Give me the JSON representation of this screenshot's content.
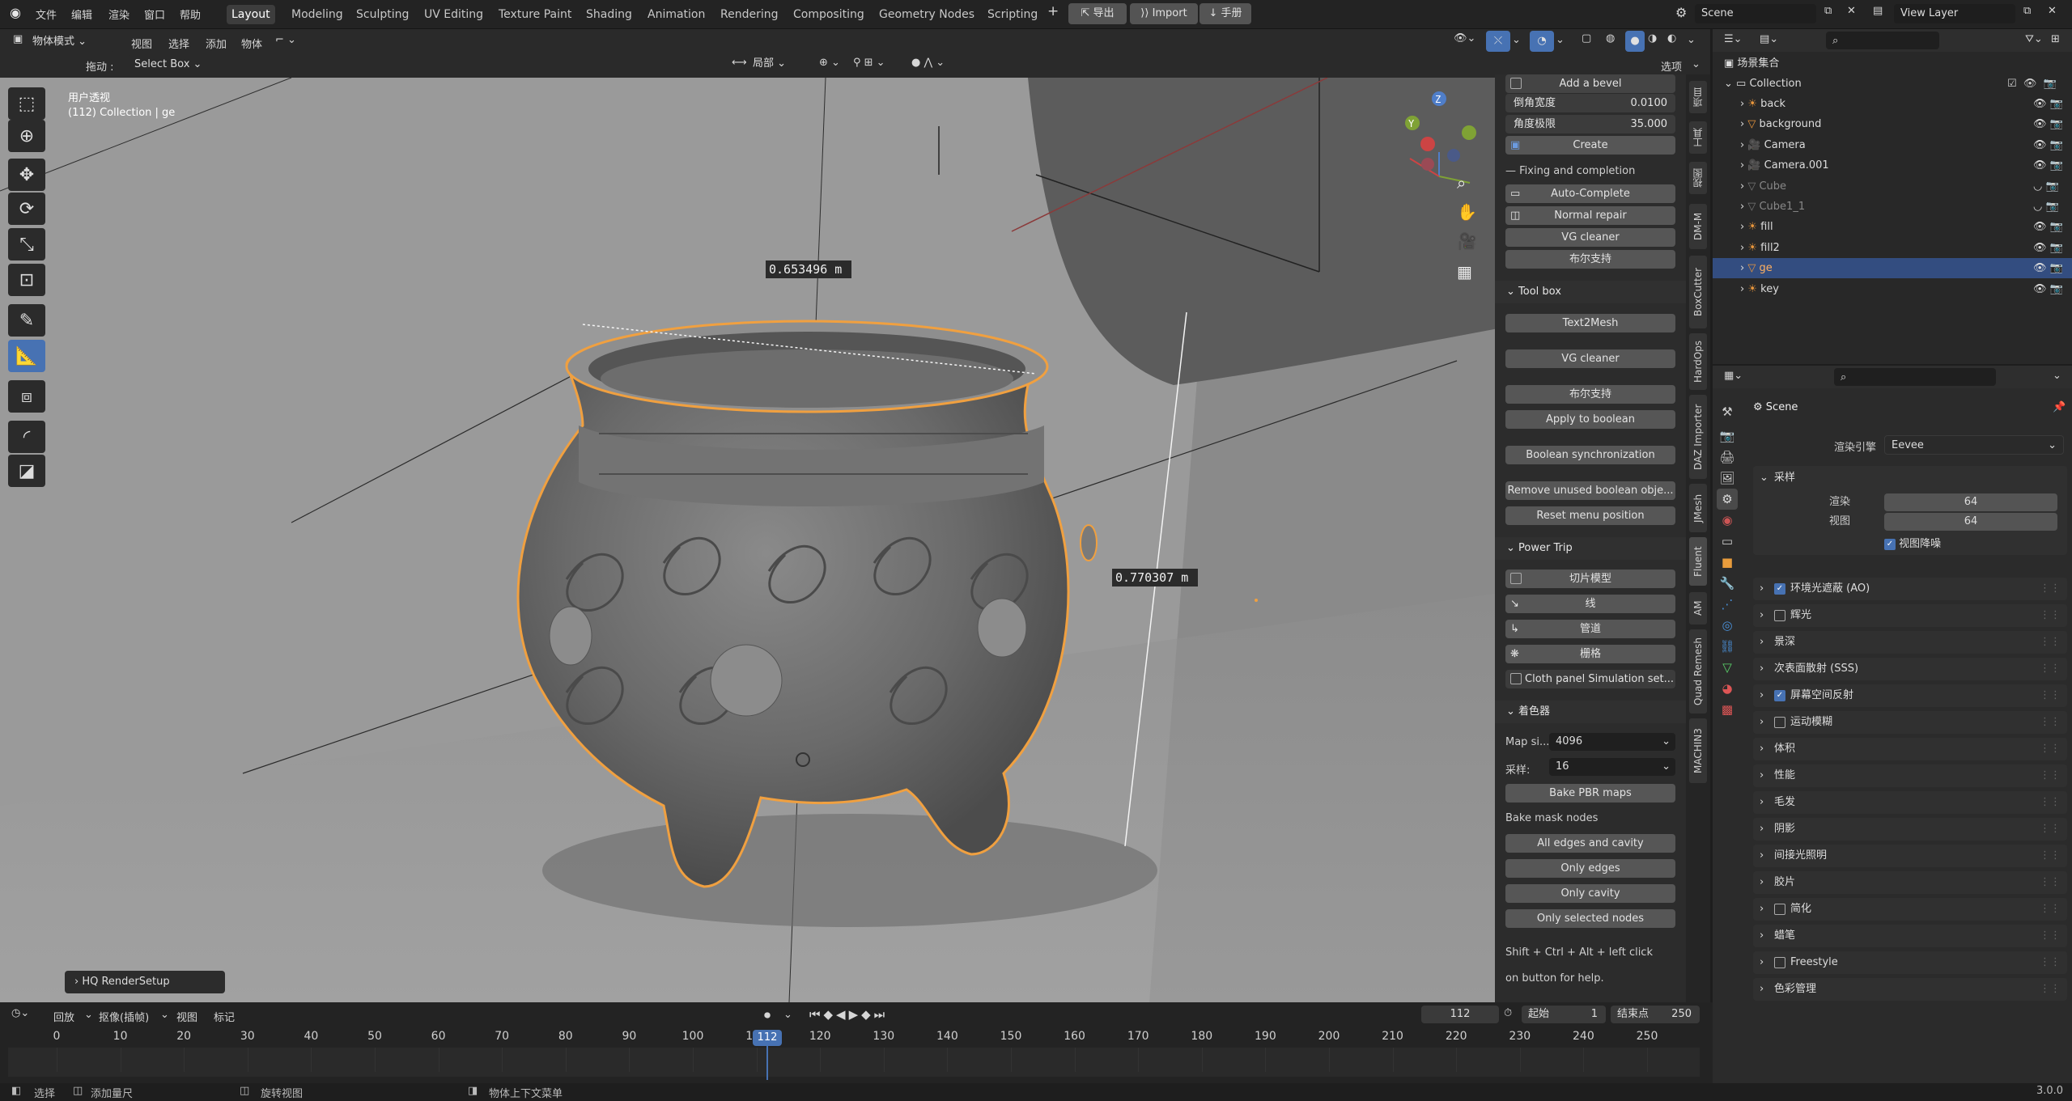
{
  "top_menu": {
    "file": "文件",
    "edit": "编辑",
    "render": "渲染",
    "window": "窗口",
    "help": "帮助"
  },
  "workspaces": [
    "Layout",
    "Modeling",
    "Sculpting",
    "UV Editing",
    "Texture Paint",
    "Shading",
    "Animation",
    "Rendering",
    "Compositing",
    "Geometry Nodes",
    "Scripting"
  ],
  "top_buttons": {
    "export": "导出",
    "import": "Import",
    "manual": "手册"
  },
  "scene": {
    "label": "Scene",
    "view_layer": "View Layer"
  },
  "viewport_header": {
    "mode": "物体模式",
    "view": "视图",
    "select": "选择",
    "add": "添加",
    "object": "物体",
    "drag_label": "拖动 :",
    "select_box": "Select Box",
    "transform": "局部",
    "options": "选项"
  },
  "viewport": {
    "view_name": "用户透视",
    "context": "(112) Collection | ge",
    "measure1": "0.653496 m",
    "measure2": "0.770307 m",
    "hq_setup": "HQ RenderSetup",
    "gizmo_x": "X",
    "gizmo_y": "Y",
    "gizmo_z": "Z"
  },
  "npanel": {
    "add_bevel": "Add a bevel",
    "bevel_width_label": "倒角宽度",
    "bevel_width": "0.0100",
    "angle_label": "角度极限",
    "angle": "35.000",
    "create": "Create",
    "fixing": "Fixing and completion",
    "auto_complete": "Auto-Complete",
    "normal_repair": "Normal repair",
    "vg_cleaner": "VG cleaner",
    "bool_support": "布尔支持",
    "toolbox": "Tool box",
    "text2mesh": "Text2Mesh",
    "vg_cleaner2": "VG cleaner",
    "bool_support2": "布尔支持",
    "apply_boolean": "Apply to boolean",
    "bool_sync": "Boolean synchronization",
    "remove_unused": "Remove unused boolean obje...",
    "reset_menu": "Reset menu position",
    "power_trip": "Power Trip",
    "slice_model": "切片模型",
    "line": "线",
    "pipe": "管道",
    "grid": "栅格",
    "cloth_panel": "Cloth panel",
    "simulation_set": "Simulation set...",
    "shader": "着色器",
    "map_size_label": "Map si...",
    "map_size": "4096",
    "samples_label": "采样:",
    "samples": "16",
    "bake_pbr": "Bake PBR maps",
    "bake_mask": "Bake mask nodes",
    "all_edges": "All edges and cavity",
    "only_edges": "Only edges",
    "only_cavity": "Only cavity",
    "only_selected": "Only selected nodes",
    "help1": "Shift + Ctrl + Alt + left click",
    "help2": "on button for help."
  },
  "side_tabs": [
    "项目",
    "工具",
    "视图",
    "DM-M",
    "BoxCutter",
    "HardOps",
    "DAZ Importer",
    "JMesh",
    "Fluent",
    "AM",
    "Quad Remesh",
    "MACHIN3"
  ],
  "outliner": {
    "root": "场景集合",
    "collection": "Collection",
    "items": [
      {
        "name": "back",
        "disabled": false,
        "selected": false
      },
      {
        "name": "background",
        "disabled": false,
        "selected": false
      },
      {
        "name": "Camera",
        "disabled": false,
        "selected": false
      },
      {
        "name": "Camera.001",
        "disabled": false,
        "selected": false
      },
      {
        "name": "Cube",
        "disabled": true,
        "selected": false
      },
      {
        "name": "Cube1_1",
        "disabled": true,
        "selected": false
      },
      {
        "name": "fill",
        "disabled": false,
        "selected": false
      },
      {
        "name": "fill2",
        "disabled": false,
        "selected": false
      },
      {
        "name": "ge",
        "disabled": false,
        "selected": true
      },
      {
        "name": "key",
        "disabled": false,
        "selected": false
      }
    ]
  },
  "properties": {
    "scene": "Scene",
    "render_engine_label": "渲染引擎",
    "render_engine": "Eevee",
    "sampling": "采样",
    "render_label": "渲染",
    "render_val": "64",
    "viewport_label": "视图",
    "viewport_val": "64",
    "denoise": "视图降噪",
    "sections": [
      {
        "label": "环境光遮蔽 (AO)",
        "check": "on"
      },
      {
        "label": "辉光",
        "check": "off"
      },
      {
        "label": "景深",
        "check": "none"
      },
      {
        "label": "次表面散射 (SSS)",
        "check": "none"
      },
      {
        "label": "屏幕空间反射",
        "check": "on"
      },
      {
        "label": "运动模糊",
        "check": "off"
      },
      {
        "label": "体积",
        "check": "none"
      },
      {
        "label": "性能",
        "check": "none"
      },
      {
        "label": "毛发",
        "check": "none"
      },
      {
        "label": "阴影",
        "check": "none"
      },
      {
        "label": "间接光照明",
        "check": "none"
      },
      {
        "label": "胶片",
        "check": "none"
      },
      {
        "label": "简化",
        "check": "off"
      },
      {
        "label": "蜡笔",
        "check": "none"
      },
      {
        "label": "Freestyle",
        "check": "off"
      },
      {
        "label": "色彩管理",
        "check": "none"
      }
    ]
  },
  "timeline": {
    "playback": "回放",
    "keying": "抠像(插帧)",
    "view": "视图",
    "marker": "标记",
    "current": "112",
    "start_label": "起始",
    "start": "1",
    "end_label": "结束点",
    "end": "250",
    "ticks": [
      "0",
      "10",
      "20",
      "30",
      "40",
      "50",
      "60",
      "70",
      "80",
      "90",
      "100",
      "110",
      "120",
      "130",
      "140",
      "150",
      "160",
      "170",
      "180",
      "190",
      "200",
      "210",
      "220",
      "230",
      "240",
      "250"
    ]
  },
  "status": {
    "select": "选择",
    "add_ruler": "添加量尺",
    "rotate_view": "旋转视图",
    "context_menu": "物体上下文菜单",
    "version": "3.0.0"
  },
  "colors": {
    "accent": "#4772b3",
    "selection": "#f0a040",
    "viewport_bg": "#7e7e7e"
  }
}
